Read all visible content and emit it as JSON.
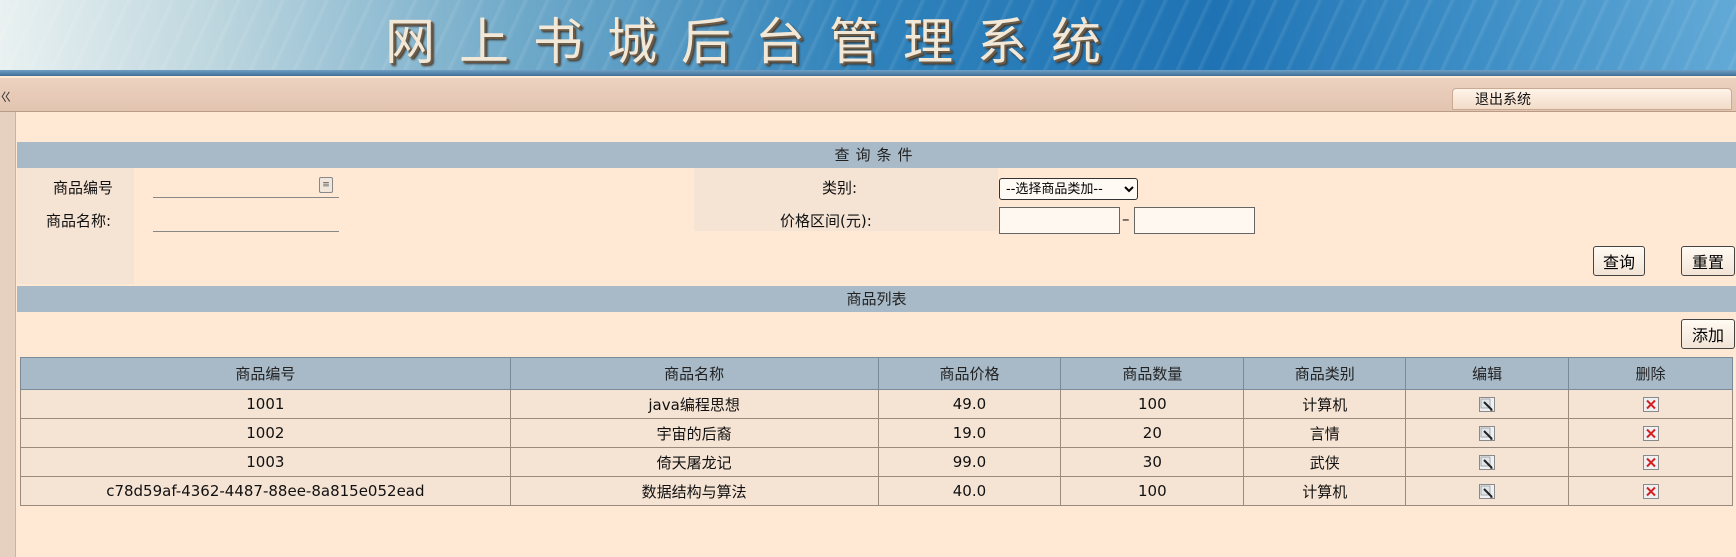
{
  "banner": {
    "title": "网上书城后台管理系统"
  },
  "topbar": {
    "left_mark": "ㄍ",
    "logout_label": "退出系统"
  },
  "query": {
    "section_title": "查询条件",
    "goods_id_label": "商品编号",
    "goods_name_label": "商品名称:",
    "category_label": "类别:",
    "category_selected": "--选择商品类加--",
    "price_label": "价格区间(元):",
    "price_dash": "–",
    "search_button": "查询",
    "reset_button": "重置"
  },
  "list": {
    "section_title": "商品列表",
    "add_button": "添加",
    "columns": [
      "商品编号",
      "商品名称",
      "商品价格",
      "商品数量",
      "商品类别",
      "编辑",
      "删除"
    ],
    "rows": [
      {
        "id": "1001",
        "name": "java编程思想",
        "price": "49.0",
        "qty": "100",
        "category": "计算机"
      },
      {
        "id": "1002",
        "name": "宇宙的后裔",
        "price": "19.0",
        "qty": "20",
        "category": "言情"
      },
      {
        "id": "1003",
        "name": "倚天屠龙记",
        "price": "99.0",
        "qty": "30",
        "category": "武侠"
      },
      {
        "id": "c78d59af-4362-4487-88ee-8a815e052ead",
        "name": "数据结构与算法",
        "price": "40.0",
        "qty": "100",
        "category": "计算机"
      }
    ]
  },
  "colors": {
    "page_bg": "#ffe8d4",
    "header_bg": "#a8bac8",
    "cell_bg": "#f5e3d4",
    "delete_red": "#d42020"
  },
  "icons": {
    "edit": "edit-pencil-icon",
    "delete": "delete-x-icon",
    "input_helper": "input-helper-icon"
  }
}
